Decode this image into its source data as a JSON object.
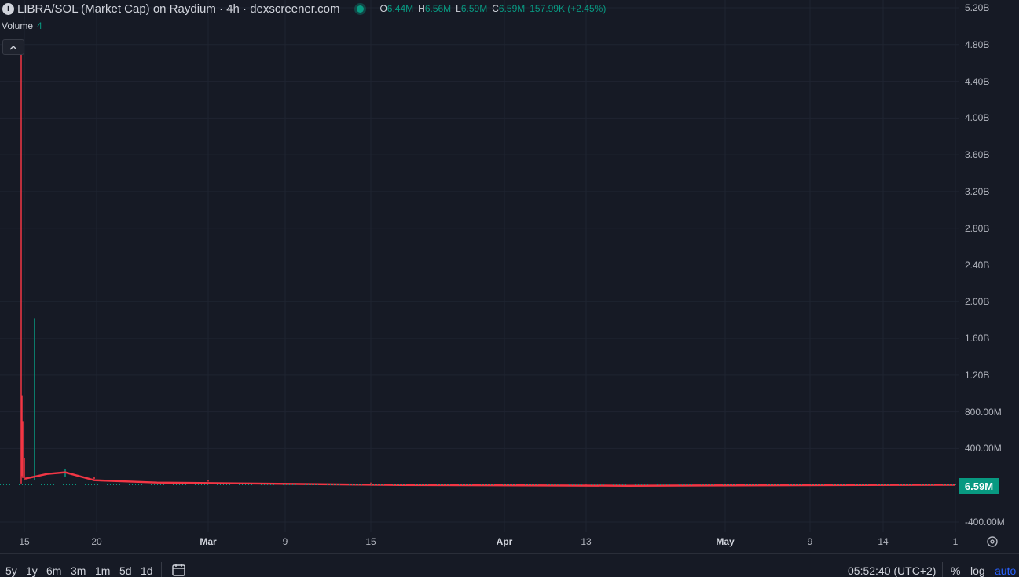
{
  "header": {
    "info_icon": "i",
    "title": "LIBRA/SOL (Market Cap) on Raydium · 4h · dexscreener.com",
    "ohlc": {
      "o_key": "O",
      "o_val": "6.44M",
      "h_key": "H",
      "h_val": "6.56M",
      "l_key": "L",
      "l_val": "6.59M",
      "c_key": "C",
      "c_val": "6.59M",
      "change": "157.99K (+2.45%)"
    }
  },
  "volume": {
    "label": "Volume",
    "value": "4"
  },
  "collapse_icon": "chevron-up-icon",
  "last_price": "6.59M",
  "colors": {
    "up": "#089981",
    "down": "#f23645",
    "background": "#161a25",
    "grid": "#1f2431",
    "accent": "#2962ff"
  },
  "chart_data": {
    "type": "candlestick",
    "title": "LIBRA/SOL (Market Cap) on Raydium · 4h · dexscreener.com",
    "ylim": [
      -400000000,
      5200000000
    ],
    "y_ticks": [
      "5.20B",
      "4.80B",
      "4.40B",
      "4.00B",
      "3.60B",
      "3.20B",
      "2.80B",
      "2.40B",
      "2.00B",
      "1.60B",
      "1.20B",
      "800.00M",
      "400.00M",
      "-400.00M"
    ],
    "x_ticks": [
      "15",
      "20",
      "Mar",
      "9",
      "15",
      "Apr",
      "13",
      "May",
      "9",
      "14",
      "1"
    ],
    "x_month_ticks": [
      "Mar",
      "Apr",
      "May"
    ],
    "series": [
      {
        "name": "Market Cap",
        "points": [
          {
            "x": "Feb 14",
            "high": 4700000000,
            "low": 20000000,
            "dir": "down"
          },
          {
            "x": "Feb 14",
            "high": 980000000,
            "low": 100000000,
            "dir": "down"
          },
          {
            "x": "Feb 14",
            "high": 700000000,
            "low": 80000000,
            "dir": "down"
          },
          {
            "x": "Feb 15",
            "high": 300000000,
            "low": 60000000,
            "dir": "down"
          },
          {
            "x": "Feb 16",
            "high": 1820000000,
            "low": 60000000,
            "dir": "up"
          },
          {
            "x": "Feb 18",
            "high": 180000000,
            "low": 90000000,
            "dir": "up"
          },
          {
            "x": "Feb 20",
            "high": 90000000,
            "low": 70000000,
            "dir": "down"
          },
          {
            "x": "Mar 1",
            "high": 55000000,
            "low": 40000000,
            "dir": "down"
          },
          {
            "x": "Mar 15",
            "high": 30000000,
            "low": 20000000,
            "dir": "down"
          },
          {
            "x": "Apr 13",
            "high": 15000000,
            "low": 8000000,
            "dir": "down"
          },
          {
            "x": "May 1",
            "high": 9000000,
            "low": 6000000,
            "dir": "up"
          },
          {
            "x": "May 14",
            "high": 7000000,
            "low": 6400000,
            "dir": "up"
          }
        ]
      }
    ],
    "last_value": 6590000
  },
  "bottom": {
    "ranges": [
      "5y",
      "1y",
      "6m",
      "3m",
      "1m",
      "5d",
      "1d"
    ],
    "clock": "05:52:40 (UTC+2)",
    "percent": "%",
    "log": "log",
    "auto": "auto"
  }
}
